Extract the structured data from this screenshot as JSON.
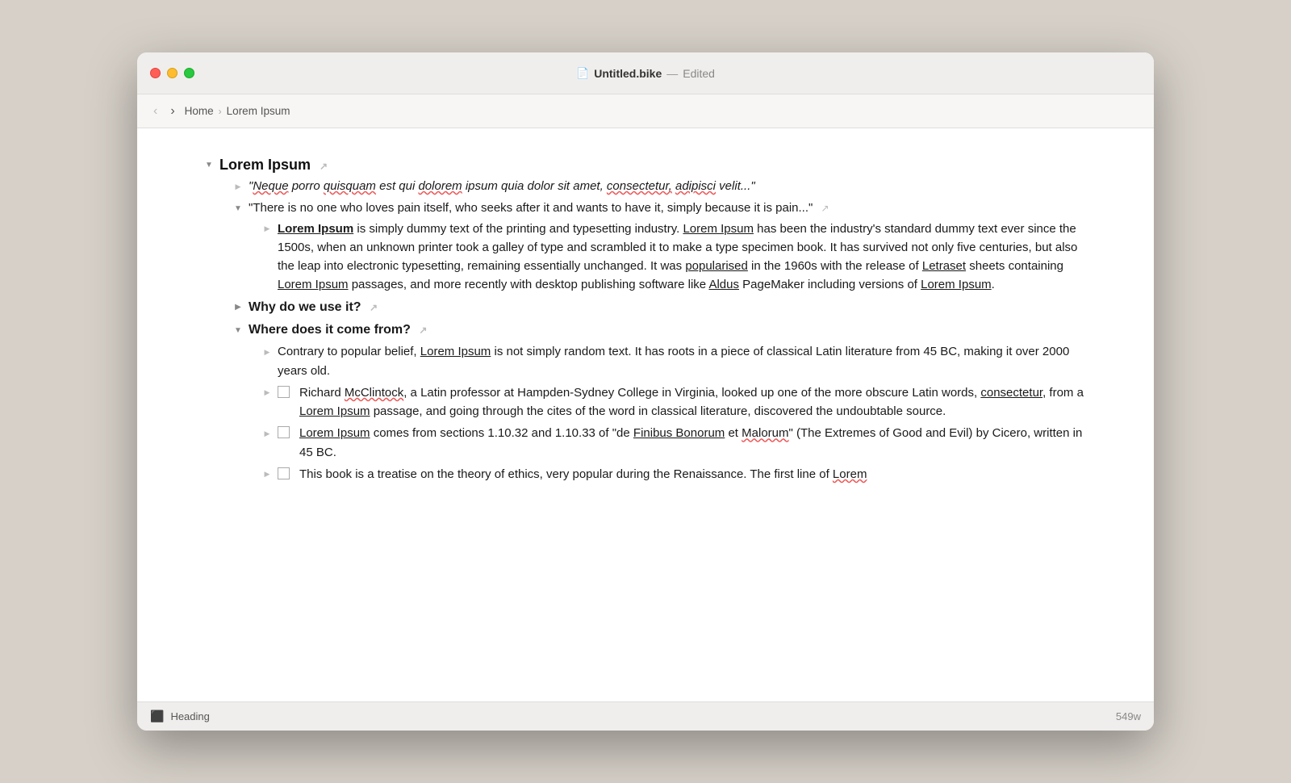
{
  "window": {
    "title_icon": "📄",
    "title_filename": "Untitled.bike",
    "title_separator": "—",
    "title_status": "Edited"
  },
  "toolbar": {
    "back_label": "‹",
    "forward_label": "›",
    "breadcrumb": [
      "Home",
      "Lorem Ipsum"
    ]
  },
  "content": {
    "heading": "Lorem Ipsum",
    "items": [
      {
        "id": "item1",
        "type": "italic",
        "text": "\"Neque porro quisquam est qui dolorem ipsum quia dolor sit amet, consectetur, adipisci velit...\""
      },
      {
        "id": "item2",
        "type": "normal",
        "expanded": true,
        "text": "\"There is no one who loves pain itself, who seeks after it and wants to have it, simply because it is pain...\""
      },
      {
        "id": "item3",
        "type": "paragraph",
        "text": "Lorem Ipsum is simply dummy text of the printing and typesetting industry. Lorem Ipsum has been the industry's standard dummy text ever since the 1500s, when an unknown printer took a galley of type and scrambled it to make a type specimen book. It has survived not only five centuries, but also the leap into electronic typesetting, remaining essentially unchanged. It was popularised in the 1960s with the release of Letraset sheets containing Lorem Ipsum passages, and more recently with desktop publishing software like Aldus PageMaker including versions of Lorem Ipsum."
      },
      {
        "id": "item4",
        "type": "subheading",
        "text": "Why do we use it?",
        "expanded": false
      },
      {
        "id": "item5",
        "type": "subheading",
        "text": "Where does it come from?",
        "expanded": true
      },
      {
        "id": "item6",
        "type": "normal",
        "text": "Contrary to popular belief, Lorem Ipsum is not simply random text. It has roots in a piece of classical Latin literature from 45 BC, making it over 2000 years old."
      },
      {
        "id": "item7",
        "type": "checkbox",
        "checked": false,
        "text": "Richard McClintock, a Latin professor at Hampden-Sydney College in Virginia, looked up one of the more obscure Latin words, consectetur, from a Lorem Ipsum passage, and going through the cites of the word in classical literature, discovered the undoubtable source."
      },
      {
        "id": "item8",
        "type": "checkbox",
        "checked": false,
        "text": "Lorem Ipsum comes from sections 1.10.32 and 1.10.33 of \"de Finibus Bonorum et Malorum\" (The Extremes of Good and Evil) by Cicero, written in 45 BC."
      },
      {
        "id": "item9",
        "type": "checkbox",
        "checked": false,
        "text": "This book is a treatise on the theory of ethics, very popular during the Renaissance. The first line of Lorem"
      }
    ]
  },
  "statusbar": {
    "icon": "⬜",
    "label": "Heading",
    "word_count": "549w"
  }
}
